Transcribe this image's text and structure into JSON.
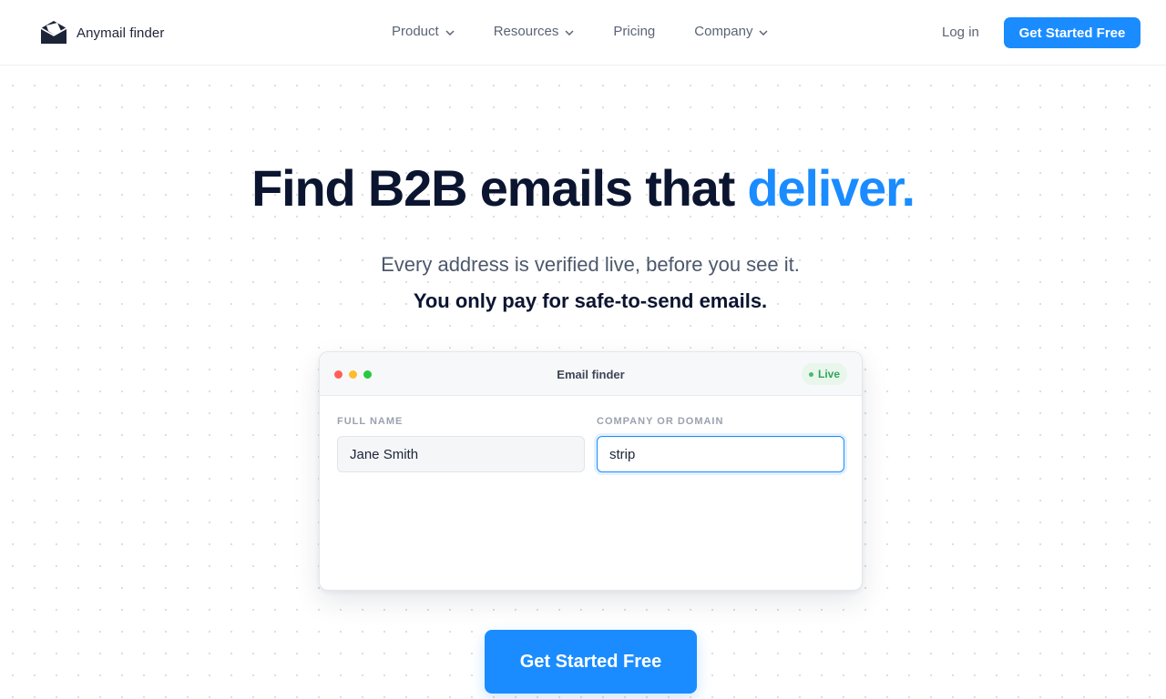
{
  "brand": {
    "name": "Anymail finder",
    "logo_icon": "envelope-logo-icon"
  },
  "nav": {
    "items": [
      {
        "label": "Product",
        "has_dropdown": true
      },
      {
        "label": "Resources",
        "has_dropdown": true
      },
      {
        "label": "Pricing",
        "has_dropdown": false
      },
      {
        "label": "Company",
        "has_dropdown": true
      }
    ],
    "login_label": "Log in",
    "cta_label": "Get Started Free"
  },
  "hero": {
    "title_main": "Find B2B emails that ",
    "title_accent": "deliver.",
    "subtitle": "Every address is verified live, before you see it.",
    "subtitle_bold": "You only pay for safe-to-send emails.",
    "cta_label": "Get Started Free"
  },
  "finder": {
    "title": "Email finder",
    "status_badge": "Live",
    "window_dots": [
      "#ff5f57",
      "#febc2e",
      "#28c840"
    ],
    "fields": {
      "full_name": {
        "label": "FULL NAME",
        "value": "Jane Smith"
      },
      "company": {
        "label": "COMPANY OR DOMAIN",
        "value": "strip"
      }
    }
  },
  "colors": {
    "accent": "#1a8cff",
    "heading": "#0b1530",
    "live_green": "#35a35a"
  }
}
